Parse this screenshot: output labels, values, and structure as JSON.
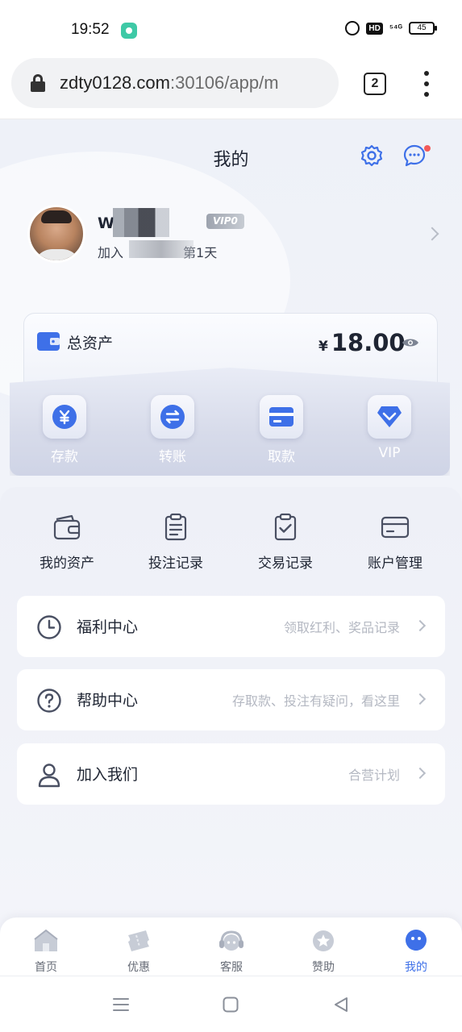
{
  "status_bar": {
    "time": "19:52",
    "hd": "HD",
    "signal": "⁵⁴ᴳ",
    "battery": "45"
  },
  "browser": {
    "url_host": "zdty0128.com",
    "url_path": ":30106/app/m",
    "tab_count": "2"
  },
  "header": {
    "title": "我的"
  },
  "profile": {
    "username": "W",
    "vip_level": "VIP0",
    "join_prefix": "加入",
    "join_suffix": "第1天"
  },
  "asset_card": {
    "label": "总资产",
    "currency": "¥",
    "amount": "18.00"
  },
  "quick_actions": [
    {
      "label": "存款",
      "icon": "yen-icon"
    },
    {
      "label": "转账",
      "icon": "transfer-icon"
    },
    {
      "label": "取款",
      "icon": "card-icon"
    },
    {
      "label": "VIP",
      "icon": "diamond-icon"
    }
  ],
  "shortcuts": [
    {
      "label": "我的资产",
      "icon": "wallet-icon"
    },
    {
      "label": "投注记录",
      "icon": "clipboard-icon"
    },
    {
      "label": "交易记录",
      "icon": "clipboard-check-icon"
    },
    {
      "label": "账户管理",
      "icon": "card-icon"
    }
  ],
  "menu": [
    {
      "title": "福利中心",
      "desc": "领取红利、奖品记录",
      "icon": "clock-icon"
    },
    {
      "title": "帮助中心",
      "desc": "存取款、投注有疑问，看这里",
      "icon": "question-icon"
    },
    {
      "title": "加入我们",
      "desc": "合营计划",
      "icon": "user-icon"
    }
  ],
  "tab_bar": [
    {
      "label": "首页",
      "icon": "home-icon"
    },
    {
      "label": "优惠",
      "icon": "ticket-icon"
    },
    {
      "label": "客服",
      "icon": "headset-icon"
    },
    {
      "label": "赞助",
      "icon": "star-icon"
    },
    {
      "label": "我的",
      "icon": "profile-icon",
      "active": true
    }
  ],
  "colors": {
    "accent": "#3e70e8",
    "page_bg": "#eef1f8"
  }
}
